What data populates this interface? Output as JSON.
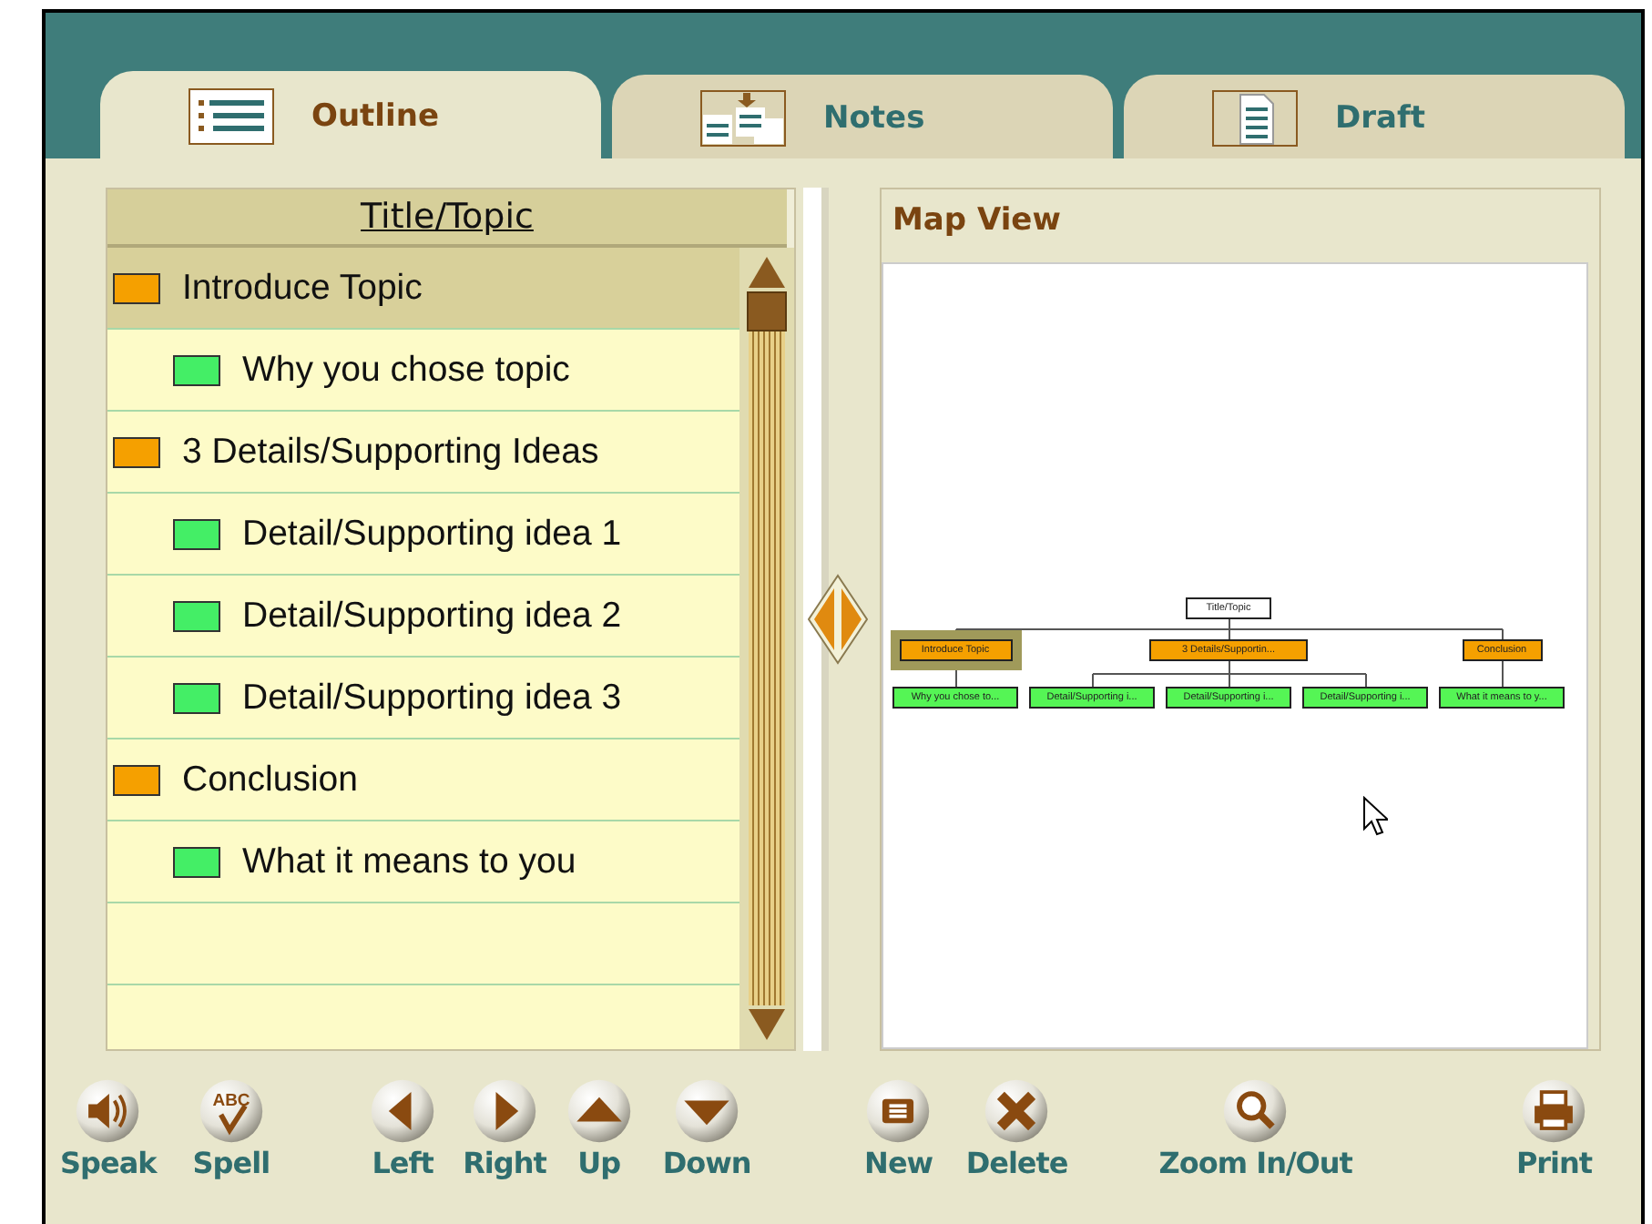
{
  "tabs": [
    {
      "label": "Outline",
      "kind": "outline",
      "selected": true
    },
    {
      "label": "Notes",
      "kind": "notes",
      "selected": false
    },
    {
      "label": "Draft",
      "kind": "draft",
      "selected": false
    }
  ],
  "outline": {
    "header": "Title/Topic",
    "rows": [
      {
        "label": "Introduce Topic",
        "selected": true,
        "children": [
          {
            "label": "Why you chose topic",
            "selected": false
          }
        ]
      },
      {
        "label": "3 Details/Supporting Ideas",
        "selected": false,
        "children": [
          {
            "label": "Detail/Supporting idea 1",
            "selected": false
          },
          {
            "label": "Detail/Supporting idea 2",
            "selected": false
          },
          {
            "label": "Detail/Supporting idea 3",
            "selected": false
          }
        ]
      },
      {
        "label": "Conclusion",
        "selected": false,
        "children": [
          {
            "label": "What it means to you",
            "selected": false
          }
        ]
      }
    ]
  },
  "map_view": {
    "title": "Map View",
    "root": {
      "label": "Title/Topic",
      "selected": false,
      "children": [
        {
          "label": "Introduce Topic",
          "selected": true,
          "children": [
            {
              "label": "Why you chose to...",
              "selected": false
            }
          ]
        },
        {
          "label": "3 Details/Supportin...",
          "selected": false,
          "children": [
            {
              "label": "Detail/Supporting i...",
              "selected": false
            },
            {
              "label": "Detail/Supporting i...",
              "selected": false
            },
            {
              "label": "Detail/Supporting i...",
              "selected": false
            }
          ]
        },
        {
          "label": "Conclusion",
          "selected": false,
          "children": [
            {
              "label": "What it means to y...",
              "selected": false
            }
          ]
        }
      ]
    }
  },
  "toolbar": [
    {
      "label": "Speak",
      "kind": "speak"
    },
    {
      "label": "Spell",
      "kind": "spell",
      "icon_text": "ABC"
    },
    {
      "label": "Left",
      "kind": "left"
    },
    {
      "label": "Right",
      "kind": "right"
    },
    {
      "label": "Up",
      "kind": "up"
    },
    {
      "label": "Down",
      "kind": "down"
    },
    {
      "label": "New",
      "kind": "new"
    },
    {
      "label": "Delete",
      "kind": "delete"
    },
    {
      "label": "Zoom In/Out",
      "kind": "zoom"
    },
    {
      "label": "Print",
      "kind": "print"
    }
  ]
}
